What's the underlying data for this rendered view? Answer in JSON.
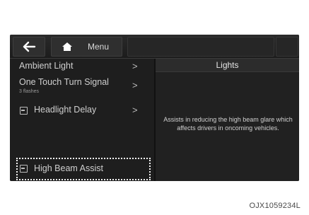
{
  "topbar": {
    "back_icon": "back-arrow-icon",
    "home_icon": "home-icon",
    "menu_label": "Menu"
  },
  "left_menu": {
    "items": [
      {
        "label": "Ambient Light",
        "sub": "",
        "chevron": ">"
      },
      {
        "label": "One Touch Turn Signal",
        "sub": "3 flashes",
        "chevron": ">"
      },
      {
        "label": "Headlight Delay",
        "sub": "",
        "chevron": ">",
        "checkbox": true
      },
      {
        "label": "High Beam Assist",
        "sub": "",
        "checkbox": true,
        "focused": true
      }
    ]
  },
  "right_panel": {
    "title": "Lights",
    "description": "Assists in reducing the high beam glare which affects drivers in oncoming vehicles."
  },
  "caption": "OJX1059234L"
}
